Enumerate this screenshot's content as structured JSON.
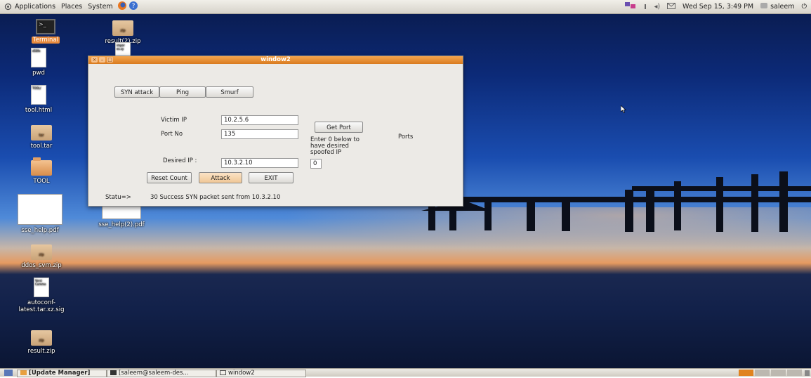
{
  "top_panel": {
    "menus": [
      "Applications",
      "Places",
      "System"
    ],
    "clock": "Wed Sep 15,  3:49 PM",
    "user": "saleem"
  },
  "desktop_icons": [
    {
      "label": "Terminal",
      "type": "terminal",
      "glyph_text": ">_"
    },
    {
      "label": "result(2).zip",
      "type": "archive"
    },
    {
      "label": "pwd",
      "type": "doc",
      "glyph_text": "d58fe"
    },
    {
      "label": "tool.html",
      "type": "doc",
      "glyph_text": "TOOL/"
    },
    {
      "label": "tool.tar",
      "type": "archive"
    },
    {
      "label": "TOOL",
      "type": "folder"
    },
    {
      "label": "sse_help.pdf",
      "type": "pdf"
    },
    {
      "label": "sse_help(2).pdf",
      "type": "pdf"
    },
    {
      "label": "ddos_svm.zip",
      "type": "archive"
    },
    {
      "label": "autoconf-latest.tar.xz.sig",
      "type": "doc",
      "glyph_text": "Versi Comme"
    },
    {
      "label": "result.zip",
      "type": "archive"
    },
    {
      "label": "",
      "type": "doc",
      "glyph_text": "impor es.sy"
    }
  ],
  "window": {
    "title": "window2",
    "attack_buttons": [
      "SYN attack",
      "Ping",
      "Smurf"
    ],
    "victim_ip_label": "Victim IP",
    "victim_ip_value": "10.2.5.6",
    "port_label": "Port No",
    "port_value": "135",
    "get_port_label": "Get Port",
    "ports_label": "Ports",
    "hint": "Enter 0 below to have desired spoofed IP",
    "spoof_value": "0",
    "desired_ip_label": "Desired IP :",
    "desired_ip_value": "10.3.2.10",
    "reset_label": "Reset Count",
    "attack_label": "Attack",
    "exit_label": "EXIT",
    "status_label": "Statu=>",
    "status_text": "30 Success SYN packet sent from 10.3.2.10"
  },
  "taskbar": {
    "items": [
      "[Update Manager]",
      "[saleem@saleem-des...",
      "window2"
    ]
  },
  "colors": {
    "accent": "#e0831f",
    "selection": "#e88a3d"
  }
}
